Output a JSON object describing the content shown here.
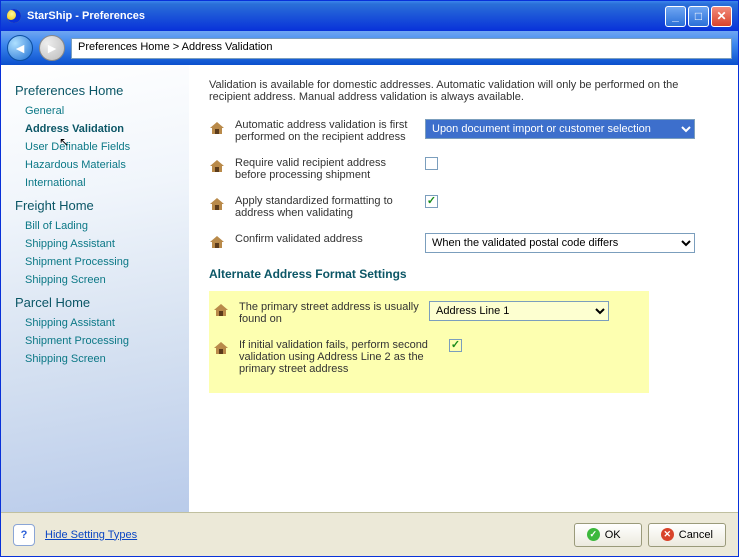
{
  "window": {
    "title": "StarShip - Preferences"
  },
  "breadcrumb": "Preferences Home > Address Validation",
  "sidebar": {
    "sections": [
      {
        "heading": "Preferences Home",
        "items": [
          {
            "label": "General",
            "active": false
          },
          {
            "label": "Address Validation",
            "active": true
          },
          {
            "label": "User Definable Fields",
            "active": false
          },
          {
            "label": "Hazardous Materials",
            "active": false
          },
          {
            "label": "International",
            "active": false
          }
        ]
      },
      {
        "heading": "Freight Home",
        "items": [
          {
            "label": "Bill of Lading"
          },
          {
            "label": "Shipping Assistant"
          },
          {
            "label": "Shipment Processing"
          },
          {
            "label": "Shipping Screen"
          }
        ]
      },
      {
        "heading": "Parcel Home",
        "items": [
          {
            "label": "Shipping Assistant"
          },
          {
            "label": "Shipment Processing"
          },
          {
            "label": "Shipping Screen"
          }
        ]
      }
    ]
  },
  "content": {
    "intro": "Validation is available for domestic addresses.  Automatic validation will only be performed on the recipient address.  Manual address validation is always available.",
    "setting_autovalidate": {
      "label": "Automatic address validation is first performed on the recipient address",
      "value": "Upon document import or customer selection"
    },
    "setting_requirevalid": {
      "label": "Require valid recipient address before processing shipment",
      "checked": false
    },
    "setting_standardize": {
      "label": "Apply standardized formatting to address when validating",
      "checked": true
    },
    "setting_confirm": {
      "label": "Confirm validated address",
      "value": "When the validated postal code differs"
    },
    "alt_heading": "Alternate Address Format Settings",
    "setting_primaryline": {
      "label": "The primary street address is usually found on",
      "value": "Address Line 1"
    },
    "setting_retrYline2": {
      "label": "If initial validation fails, perform second validation using Address Line 2 as the primary street address",
      "checked": true
    }
  },
  "footer": {
    "link": "Hide Setting Types",
    "ok": "OK",
    "cancel": "Cancel"
  }
}
